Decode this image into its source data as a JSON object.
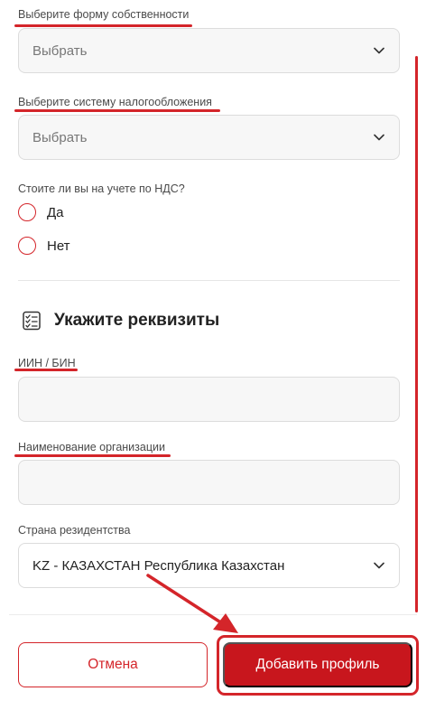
{
  "form": {
    "ownership": {
      "label": "Выберите форму собственности",
      "value": "Выбрать"
    },
    "taxation": {
      "label": "Выберите систему налогообложения",
      "value": "Выбрать"
    },
    "vat": {
      "question": "Стоите ли вы на учете по НДС?",
      "options": [
        "Да",
        "Нет"
      ]
    }
  },
  "requisites": {
    "title": "Укажите реквизиты",
    "iin": {
      "label": "ИИН / БИН",
      "value": ""
    },
    "org_name": {
      "label": "Наименование организации",
      "value": ""
    },
    "residency": {
      "label": "Страна резидентства",
      "value": "KZ - КАЗАХСТАН Республика Казахстан"
    }
  },
  "actions": {
    "cancel_label": "Отмена",
    "add_label": "Добавить профиль"
  },
  "colors": {
    "accent": "#c8161d",
    "annotation": "#d4252a"
  },
  "icons": {
    "dropdown": "chevron-down-icon",
    "section": "checklist-icon"
  }
}
